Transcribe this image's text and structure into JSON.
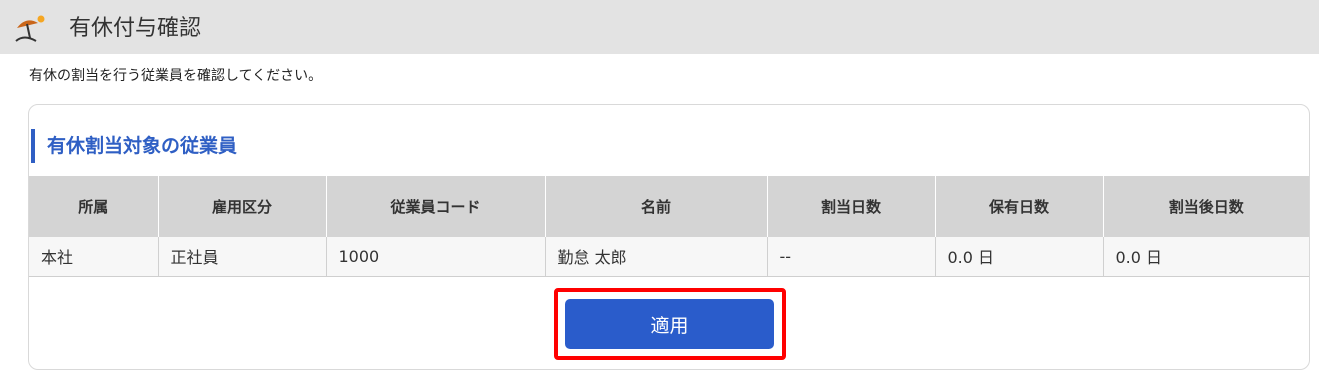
{
  "header": {
    "title": "有休付与確認",
    "icon": "beach-umbrella-icon",
    "icon_colors": {
      "umbrella": "#c9661a",
      "sun": "#f5a623",
      "sand": "#333333"
    }
  },
  "instruction": "有休の割当を行う従業員を確認してください。",
  "section": {
    "title": "有休割当対象の従業員",
    "accent_color": "#2f5fc4"
  },
  "table": {
    "columns": [
      "所属",
      "雇用区分",
      "従業員コード",
      "名前",
      "割当日数",
      "保有日数",
      "割当後日数"
    ],
    "rows": [
      [
        "本社",
        "正社員",
        "1000",
        "勤怠 太郎",
        "--",
        "0.0 日",
        "0.0 日"
      ]
    ]
  },
  "apply_button": {
    "label": "適用",
    "color": "#2a5ccb",
    "highlight_color": "#ff0000"
  }
}
